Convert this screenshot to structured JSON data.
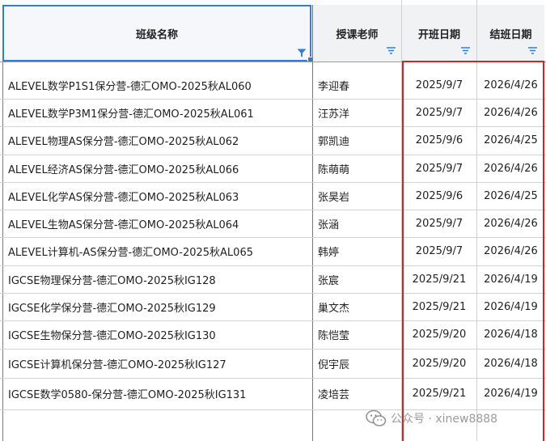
{
  "header": {
    "columns": [
      {
        "label": "班级名称"
      },
      {
        "label": "授课老师"
      },
      {
        "label": "开班日期"
      },
      {
        "label": "结班日期"
      }
    ]
  },
  "rows": [
    {
      "name": "ALEVEL数学P1S1保分营-德汇OMO-2025秋AL060",
      "teacher": "李迎春",
      "start": "2025/9/7",
      "end": "2026/4/26"
    },
    {
      "name": "ALEVEL数学P3M1保分营-德汇OMO-2025秋AL061",
      "teacher": "汪苏洋",
      "start": "2025/9/7",
      "end": "2026/4/26"
    },
    {
      "name": "ALEVEL物理AS保分营-德汇OMO-2025秋AL062",
      "teacher": "郭凯迪",
      "start": "2025/9/6",
      "end": "2026/4/25"
    },
    {
      "name": "ALEVEL经济AS保分营-德汇OMO-2025秋AL066",
      "teacher": "陈萌萌",
      "start": "2025/9/7",
      "end": "2026/4/26"
    },
    {
      "name": "ALEVEL化学AS保分营-德汇OMO-2025秋AL063",
      "teacher": "张昊岩",
      "start": "2025/9/6",
      "end": "2026/4/25"
    },
    {
      "name": "ALEVEL生物AS保分营-德汇OMO-2025秋AL064",
      "teacher": "张涵",
      "start": "2025/9/7",
      "end": "2026/4/26"
    },
    {
      "name": "ALEVEL计算机-AS保分营-德汇OMO-2025秋AL065",
      "teacher": "韩婷",
      "start": "2025/9/7",
      "end": "2026/4/26"
    },
    {
      "name": "IGCSE物理保分营-德汇OMO-2025秋IG128",
      "teacher": "张宸",
      "start": "2025/9/21",
      "end": "2026/4/19"
    },
    {
      "name": "IGCSE化学保分营-德汇OMO-2025秋IG129",
      "teacher": "巢文杰",
      "start": "2025/9/21",
      "end": "2026/4/19"
    },
    {
      "name": "IGCSE生物保分营-德汇OMO-2025秋IG130",
      "teacher": "陈恺莹",
      "start": "2025/9/20",
      "end": "2026/4/18"
    },
    {
      "name": "IGCSE计算机保分营-德汇OMO-2025秋IG127",
      "teacher": "倪宇辰",
      "start": "2025/9/20",
      "end": "2026/4/18"
    },
    {
      "name": "IGCSE数学0580-保分营-德汇OMO-2025秋IG131",
      "teacher": "凌培芸",
      "start": "2025/9/21",
      "end": "2026/4/19"
    }
  ],
  "watermark": {
    "text": "公众号 · xinew8888"
  },
  "colors": {
    "header_bg": "#f1f2f4",
    "selection": "#2f7de1",
    "filter_icon": "#2f7de1",
    "highlight_box": "#e02020",
    "text": "#1f1f1f"
  }
}
